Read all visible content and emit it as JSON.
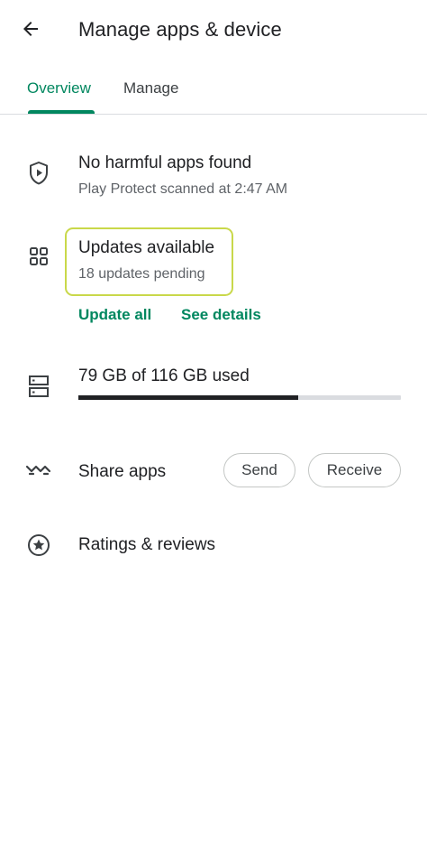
{
  "header": {
    "title": "Manage apps & device",
    "back_icon": "arrow-back-icon"
  },
  "tabs": [
    {
      "label": "Overview",
      "selected": true
    },
    {
      "label": "Manage",
      "selected": false
    }
  ],
  "protect": {
    "icon": "shield-play-icon",
    "title": "No harmful apps found",
    "subtitle": "Play Protect scanned at 2:47 AM"
  },
  "updates": {
    "icon": "apps-grid-icon",
    "title": "Updates available",
    "subtitle": "18 updates pending",
    "update_all_label": "Update all",
    "see_details_label": "See details"
  },
  "storage": {
    "icon": "storage-icon",
    "text": "79 GB of 116 GB used",
    "used_gb": 79,
    "total_gb": 116
  },
  "share": {
    "icon": "nearby-share-icon",
    "label": "Share apps",
    "send_label": "Send",
    "receive_label": "Receive"
  },
  "ratings": {
    "icon": "star-circle-icon",
    "label": "Ratings & reviews"
  },
  "colors": {
    "accent": "#01875f",
    "highlight_border": "#c9d84a",
    "text_primary": "#202124",
    "text_secondary": "#5f6368"
  }
}
